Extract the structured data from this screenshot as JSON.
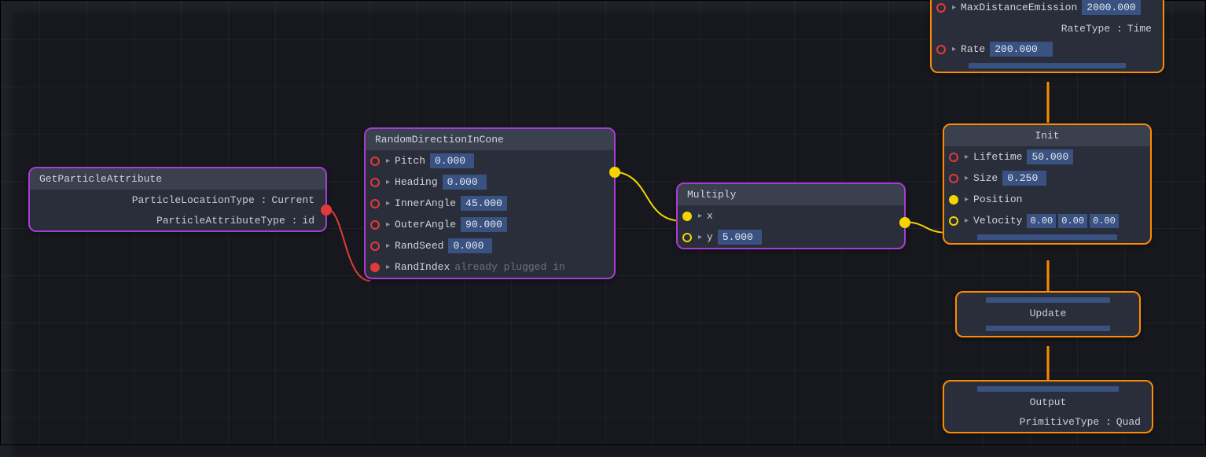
{
  "nodes": {
    "getParticle": {
      "title": "GetParticleAttribute",
      "particleLocationType": {
        "k": "ParticleLocationType",
        "v": "Current"
      },
      "particleAttributeType": {
        "k": "ParticleAttributeType",
        "v": "id"
      }
    },
    "randomCone": {
      "title": "RandomDirectionInCone",
      "pitch": {
        "label": "Pitch",
        "value": "0.000"
      },
      "heading": {
        "label": "Heading",
        "value": "0.000"
      },
      "innerAngle": {
        "label": "InnerAngle",
        "value": "45.000"
      },
      "outerAngle": {
        "label": "OuterAngle",
        "value": "90.000"
      },
      "randSeed": {
        "label": "RandSeed",
        "value": "0.000"
      },
      "randIndex": {
        "label": "RandIndex",
        "placeholder": "already plugged in"
      }
    },
    "multiply": {
      "title": "Multiply",
      "x": {
        "label": "x"
      },
      "y": {
        "label": "y",
        "value": "5.000"
      }
    },
    "emitter": {
      "maxDistance": {
        "label": "MaxDistanceEmission",
        "value": "2000.000"
      },
      "rateType": {
        "k": "RateType",
        "v": "Time"
      },
      "rate": {
        "label": "Rate",
        "value": "200.000"
      }
    },
    "init": {
      "title": "Init",
      "lifetime": {
        "label": "Lifetime",
        "value": "50.000"
      },
      "size": {
        "label": "Size",
        "value": "0.250"
      },
      "position": {
        "label": "Position"
      },
      "velocity": {
        "label": "Velocity",
        "x": "0.00",
        "y": "0.00",
        "z": "0.00"
      }
    },
    "update": {
      "title": "Update"
    },
    "output": {
      "title": "Output",
      "primitiveType": {
        "k": "PrimitiveType",
        "v": "Quad"
      }
    }
  }
}
